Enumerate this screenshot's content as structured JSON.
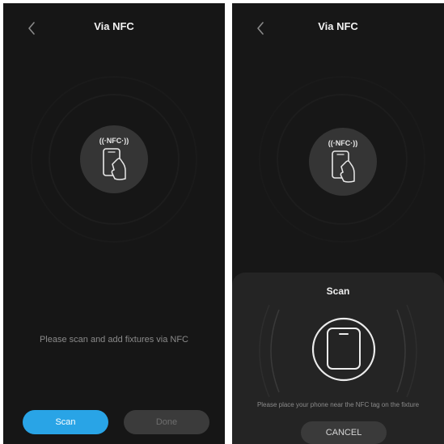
{
  "left": {
    "header": {
      "title": "Via NFC"
    },
    "badge": {
      "label": "((·NFC·))"
    },
    "hint": "Please scan and add fixtures via NFC",
    "buttons": {
      "scan_label": "Scan",
      "done_label": "Done"
    }
  },
  "right": {
    "header": {
      "title": "Via NFC"
    },
    "badge": {
      "label": "((·NFC·))"
    },
    "sheet": {
      "title": "Scan",
      "hint": "Please place your phone near the NFC tag on the fixture",
      "cancel_label": "CANCEL"
    }
  },
  "icons": {
    "back": "chevron-left-icon",
    "nfc": "nfc-phone-hand-icon",
    "phone": "phone-icon"
  },
  "colors": {
    "background": "#161616",
    "accent": "#29a4e6",
    "disabled_button": "#3b3b3b",
    "sheet": "#242424"
  }
}
